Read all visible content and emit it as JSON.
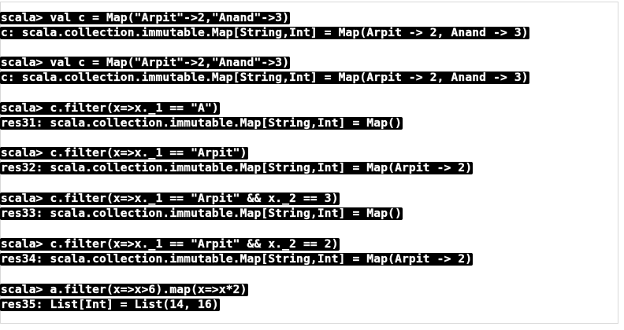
{
  "repl": {
    "blocks": [
      {
        "prompt": "scala> val c = Map(\"Arpit\"->2,\"Anand\"->3)",
        "result": "c: scala.collection.immutable.Map[String,Int] = Map(Arpit -> 2, Anand -> 3)"
      },
      {
        "prompt": "scala> val c = Map(\"Arpit\"->2,\"Anand\"->3)",
        "result": "c: scala.collection.immutable.Map[String,Int] = Map(Arpit -> 2, Anand -> 3)"
      },
      {
        "prompt": "scala> c.filter(x=>x._1 == \"A\")",
        "result": "res31: scala.collection.immutable.Map[String,Int] = Map()"
      },
      {
        "prompt": "scala> c.filter(x=>x._1 == \"Arpit\")",
        "result": "res32: scala.collection.immutable.Map[String,Int] = Map(Arpit -> 2)"
      },
      {
        "prompt": "scala> c.filter(x=>x._1 == \"Arpit\" && x._2 == 3)",
        "result": "res33: scala.collection.immutable.Map[String,Int] = Map()"
      },
      {
        "prompt": "scala> c.filter(x=>x._1 == \"Arpit\" && x._2 == 2)",
        "result": "res34: scala.collection.immutable.Map[String,Int] = Map(Arpit -> 2)"
      },
      {
        "prompt": "scala> a.filter(x=>x>6).map(x=>x*2)",
        "result": "res35: List[Int] = List(14, 16)"
      }
    ]
  }
}
